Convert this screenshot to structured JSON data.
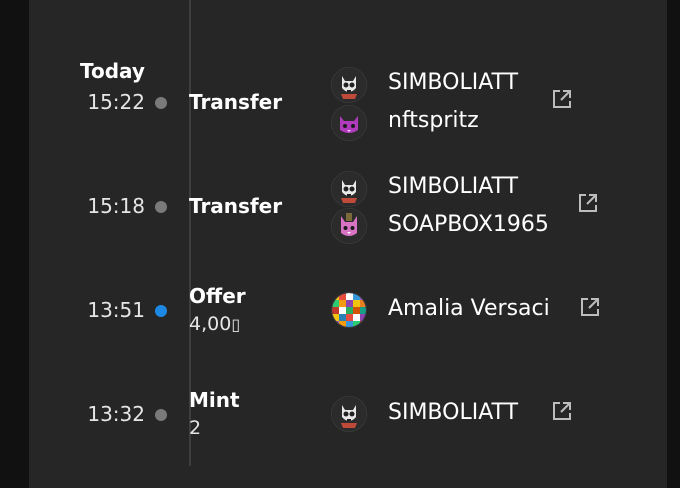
{
  "activity": {
    "day_label": "Today",
    "events": [
      {
        "time": "15:22",
        "type": "Transfer",
        "from": {
          "name": "SIMBOLIATT",
          "avatar": "skull-cat-avatar"
        },
        "to": {
          "name": "nftspritz",
          "avatar": "purple-cat-avatar"
        }
      },
      {
        "time": "15:18",
        "type": "Transfer",
        "from": {
          "name": "SIMBOLIATT",
          "avatar": "skull-cat-avatar"
        },
        "to": {
          "name": "SOAPBOX1965",
          "avatar": "pink-cat-avatar"
        }
      },
      {
        "time": "13:51",
        "type": "Offer",
        "detail": "4,00",
        "currency_glyph": "▯",
        "user": {
          "name": "Amalia Versaci",
          "avatar": "mosaic-avatar"
        }
      },
      {
        "time": "13:32",
        "type": "Mint",
        "detail": "2",
        "user": {
          "name": "SIMBOLIATT",
          "avatar": "skull-cat-avatar"
        }
      }
    ]
  },
  "colors": {
    "panel_bg": "#262626",
    "page_bg": "#111111",
    "line": "#3e3e3e",
    "dot_default": "#7a7a7a",
    "dot_offer": "#1e88e5",
    "link_icon": "#bdbdbd"
  },
  "icons": {
    "external_link": "external-link-icon"
  }
}
